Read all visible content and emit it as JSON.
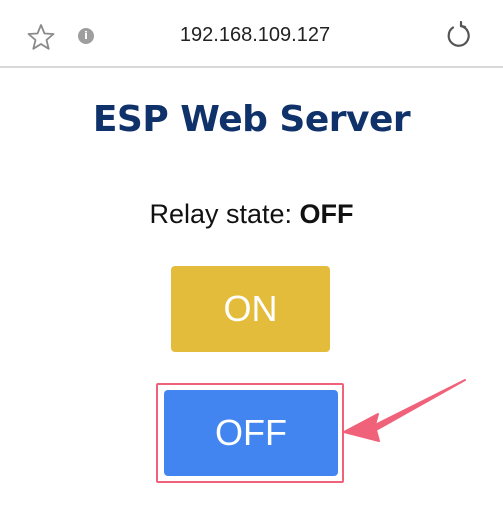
{
  "browser": {
    "url": "192.168.109.127",
    "icons": {
      "favorite": "star-icon",
      "site_info": "info-icon",
      "reload": "reload-icon"
    },
    "info_glyph": "i"
  },
  "page": {
    "title": "ESP Web Server",
    "relay_label": "Relay state: ",
    "relay_value": "OFF",
    "buttons": {
      "on_label": "ON",
      "off_label": "OFF"
    }
  },
  "colors": {
    "title": "#10326b",
    "on_button": "#e4bc3c",
    "off_button": "#4285f0",
    "annotation": "#f0627a"
  }
}
